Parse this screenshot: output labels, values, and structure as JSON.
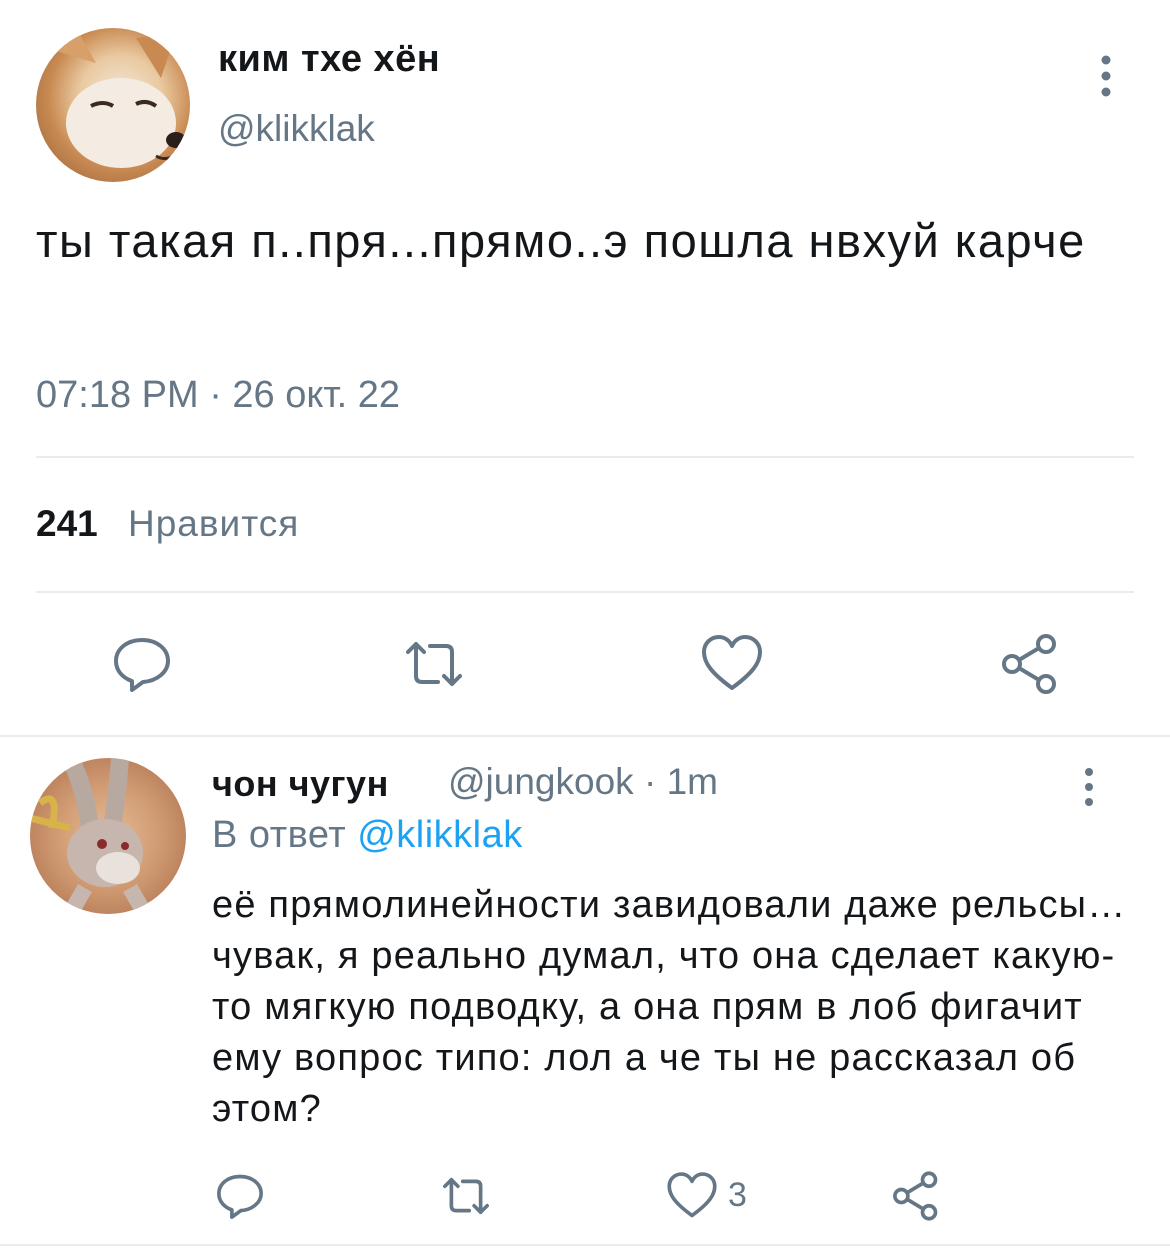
{
  "tweet": {
    "author_name": "ким тхе хён",
    "author_handle": "@klikklak",
    "text": "ты такая п..пря...прямо..э пошла нвхуй карче",
    "timestamp": "07:18 PM · 26 окт. 22",
    "likes_count": "241",
    "likes_label": "Нравится",
    "avatar_icon": "shiba-dog-avatar",
    "actions": [
      "reply-icon",
      "retweet-icon",
      "like-icon",
      "share-icon"
    ]
  },
  "reply": {
    "author_name": "чон чугун",
    "author_handle": "@jungkook",
    "separator": "·",
    "time": "1m",
    "reply_to_prefix": "В ответ",
    "reply_to_handle": "@klikklak",
    "text": "её прямолинейности завидовали даже рельсы… чувак, я реально думал, что она сделает какую-то мягкую подводку, а она прям в лоб фигачит ему вопрос типо: лол а че ты не рассказал об этом?",
    "like_count": "3",
    "avatar_icon": "bugs-bunny-avatar",
    "actions": [
      "reply-icon",
      "retweet-icon",
      "like-icon",
      "share-icon"
    ]
  },
  "colors": {
    "text_primary": "#14171a",
    "text_secondary": "#657786",
    "link": "#1da1f2",
    "divider": "#e6ecf0"
  }
}
